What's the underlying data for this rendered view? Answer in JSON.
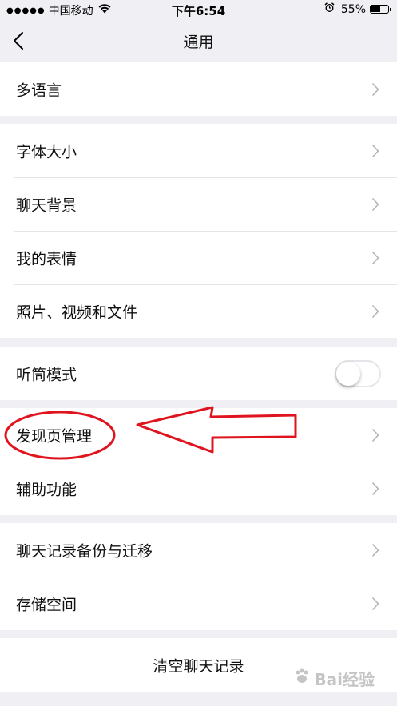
{
  "status": {
    "carrier": "中国移动",
    "time": "下午6:54",
    "battery": "55%",
    "battery_level": 0.55,
    "icons": [
      "signal-icon",
      "wifi-icon",
      "alarm-icon",
      "battery-icon"
    ]
  },
  "nav": {
    "title": "通用",
    "back_icon": "chevron-left-icon"
  },
  "groups": [
    {
      "items": [
        {
          "label": "多语言"
        }
      ]
    },
    {
      "items": [
        {
          "label": "字体大小"
        },
        {
          "label": "聊天背景"
        },
        {
          "label": "我的表情"
        },
        {
          "label": "照片、视频和文件"
        }
      ]
    },
    {
      "items": [
        {
          "label": "听筒模式",
          "toggle": false
        }
      ]
    },
    {
      "items": [
        {
          "label": "发现页管理"
        },
        {
          "label": "辅助功能"
        }
      ]
    },
    {
      "items": [
        {
          "label": "聊天记录备份与迁移"
        },
        {
          "label": "存储空间"
        }
      ]
    }
  ],
  "clear": {
    "label": "清空聊天记录"
  },
  "annotation": {
    "color": "#e0141e",
    "shapes": [
      "ellipse-highlight",
      "arrow-left"
    ]
  },
  "watermark": {
    "text": "Bai经验"
  }
}
